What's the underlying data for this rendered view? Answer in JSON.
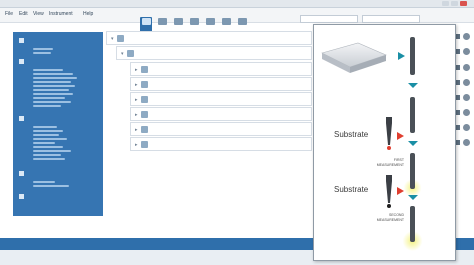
{
  "colors": {
    "accent": "#2f6fab",
    "sidebar": "#3675b2",
    "arrow_teal": "#1a8fa5",
    "arrow_red": "#e03e2f",
    "glow": "#f4f27a"
  },
  "menu": [
    {
      "label": "File"
    },
    {
      "label": "Edit"
    },
    {
      "label": "View"
    },
    {
      "label": "Instrument"
    },
    {
      "label": "Help"
    }
  ],
  "panel": {
    "substrate_label_1": "Substrate",
    "substrate_label_2": "Substrate",
    "first_measurement": "FIRST\nMEASUREMENT",
    "second_measurement": "SECOND\nMEASUREMENT"
  }
}
